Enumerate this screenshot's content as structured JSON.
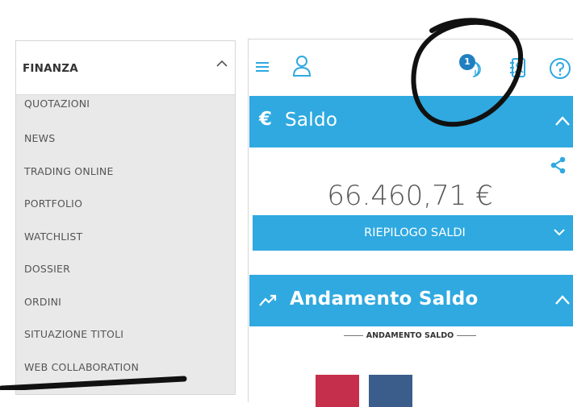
{
  "sidebar": {
    "title": "FINANZA",
    "items": [
      {
        "label": "QUOTAZIONI"
      },
      {
        "label": "NEWS"
      },
      {
        "label": "TRADING ONLINE"
      },
      {
        "label": "PORTFOLIO"
      },
      {
        "label": "WATCHLIST"
      },
      {
        "label": "DOSSIER"
      },
      {
        "label": "ORDINI"
      },
      {
        "label": "SITUAZIONE TITOLI"
      },
      {
        "label": "WEB COLLABORATION"
      }
    ]
  },
  "topbar": {
    "icons": [
      "hamburger-icon",
      "user-icon",
      "notifications-icon",
      "address-book-icon",
      "help-icon"
    ],
    "notification_count": "1"
  },
  "saldo": {
    "currency_symbol": "€",
    "title": "Saldo",
    "balance": "66.460,71 €",
    "summary_label": "RIEPILOGO SALDI"
  },
  "trend": {
    "title": "Andamento Saldo",
    "subtitle": "ANDAMENTO SALDO"
  },
  "colors": {
    "accent": "#2fa9e0",
    "badge": "#1f7fc0",
    "bar_red": "#c62f4c",
    "bar_blue": "#3b5d8c"
  }
}
